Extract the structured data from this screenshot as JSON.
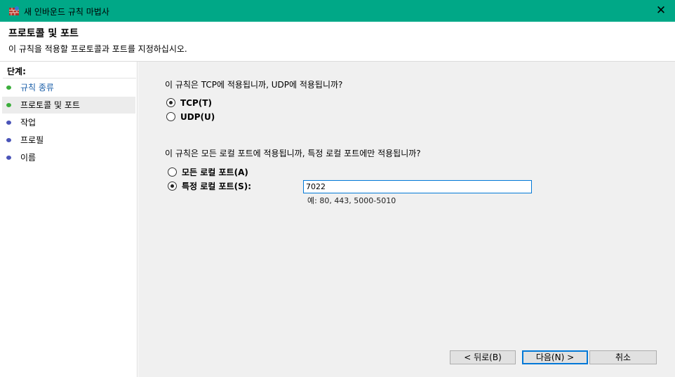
{
  "window": {
    "title": "새 인바운드 규칙 마법사",
    "close_glyph": "✕"
  },
  "header": {
    "title": "프로토콜 및 포트",
    "description": "이 규칙을 적용할 프로토콜과 포트를 지정하십시오."
  },
  "sidebar": {
    "steps_label": "단계:",
    "steps": [
      {
        "label": "규칙 종류",
        "status": "done"
      },
      {
        "label": "프로토콜 및 포트",
        "status": "current"
      },
      {
        "label": "작업",
        "status": "todo"
      },
      {
        "label": "프로필",
        "status": "todo"
      },
      {
        "label": "이름",
        "status": "todo"
      }
    ]
  },
  "main": {
    "protocol_question": "이 규칙은 TCP에 적용됩니까, UDP에 적용됩니까?",
    "protocol_options": [
      {
        "label": "TCP(T)",
        "selected": true
      },
      {
        "label": "UDP(U)",
        "selected": false
      }
    ],
    "port_question": "이 규칙은 모든 로컬 포트에 적용됩니까, 특정 로컬 포트에만 적용됩니까?",
    "port_options": [
      {
        "label": "모든 로컬 포트(A)",
        "selected": false
      },
      {
        "label": "특정 로컬 포트(S):",
        "selected": true
      }
    ],
    "port_value": "7022",
    "port_example": "예: 80, 443, 5000-5010"
  },
  "buttons": {
    "back": "< 뒤로(B)",
    "next": "다음(N) >",
    "cancel": "취소"
  },
  "colors": {
    "titlebar": "#00a887",
    "done_dot": "#3cae3c",
    "todo_dot": "#4a54b8",
    "focus": "#0078d7"
  }
}
